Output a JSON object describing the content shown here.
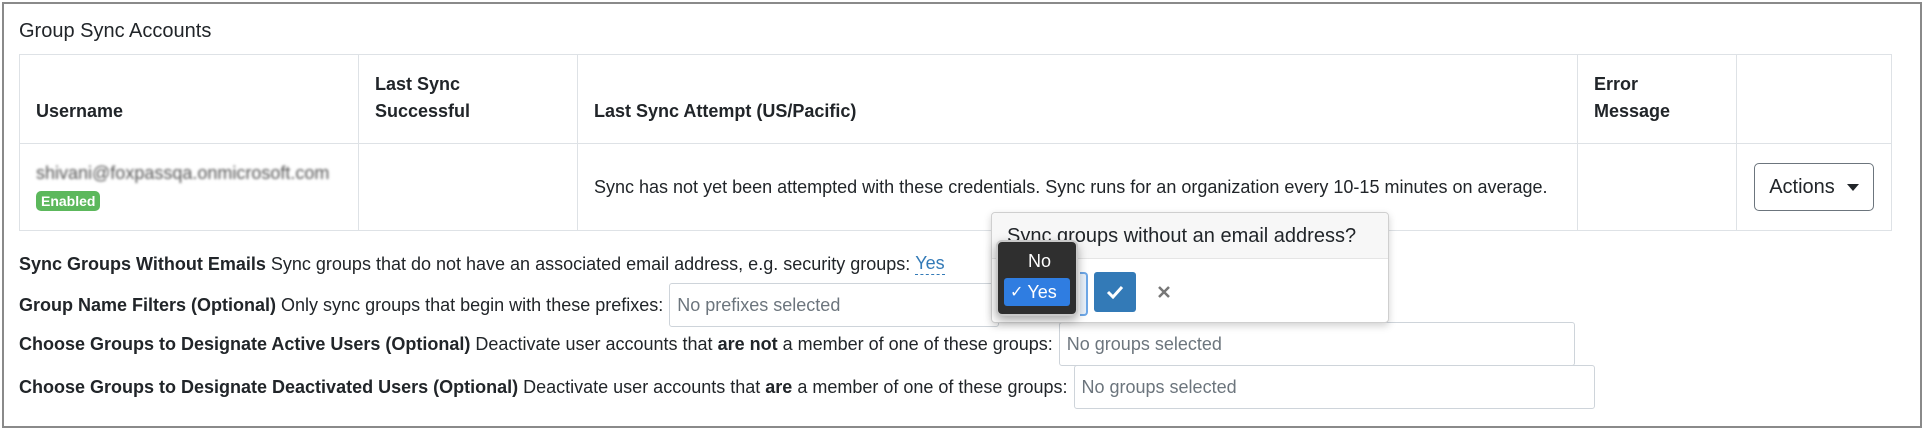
{
  "panel": {
    "title": "Group Sync Accounts"
  },
  "table": {
    "headers": [
      "Username",
      "Last Sync Successful",
      "Last Sync Attempt (US/Pacific)",
      "Error Message",
      ""
    ],
    "header_line1": [
      "",
      "Last Sync",
      "",
      "Error",
      ""
    ],
    "header_line2": [
      "Username",
      "Successful",
      "Last Sync Attempt (US/Pacific)",
      "Message",
      ""
    ],
    "rows": [
      {
        "username": "shivani@foxpassqa.onmicrosoft.com",
        "status_badge": "Enabled",
        "last_sync_successful": "",
        "last_sync_attempt": "Sync has not yet been attempted with these credentials. Sync runs for an organization every 10-15 minutes on average.",
        "error_message": "",
        "actions_label": "Actions"
      }
    ]
  },
  "settings": {
    "without_emails": {
      "label": "Sync Groups Without Emails",
      "description": "Sync groups that do not have an associated email address, e.g. security groups:",
      "value": "Yes"
    },
    "name_filters": {
      "label": "Group Name Filters (Optional)",
      "description": "Only sync groups that begin with these prefixes:",
      "placeholder": "No prefixes selected"
    },
    "active_users": {
      "label": "Choose Groups to Designate Active Users (Optional)",
      "desc_before": "Deactivate user accounts that",
      "desc_bold": "are not",
      "desc_after": "a member of one of these groups:",
      "placeholder": "No groups selected"
    },
    "deactivated_users": {
      "label": "Choose Groups to Designate Deactivated Users (Optional)",
      "desc_before": "Deactivate user accounts that",
      "desc_bold": "are",
      "desc_after": "a member of one of these groups:",
      "placeholder": "No groups selected"
    }
  },
  "popover": {
    "title": "Sync groups without an email address?",
    "options": [
      "No",
      "Yes"
    ],
    "selected": "Yes",
    "check_glyph": "✓"
  },
  "colors": {
    "accent": "#337ab7",
    "badge": "#5cb85c",
    "selected_option": "#2f7de1"
  }
}
